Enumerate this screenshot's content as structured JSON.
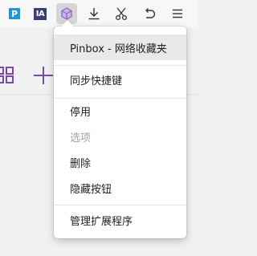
{
  "toolbar": {
    "extensions": [
      {
        "name": "pocket-extension",
        "label": "P",
        "color": "#1f95d8"
      },
      {
        "name": "internet-archive-extension",
        "label": "IA",
        "color": "#3a3f73"
      },
      {
        "name": "pinbox-extension",
        "active": true
      }
    ],
    "icons": [
      "download-icon",
      "scissors-icon",
      "undo-icon",
      "menu-icon"
    ]
  },
  "context_menu": {
    "title": "Pinbox - 网络收藏夹",
    "items": [
      {
        "label": "同步快捷键",
        "enabled": true
      },
      {
        "label": "停用",
        "enabled": true
      },
      {
        "label": "选项",
        "enabled": false
      },
      {
        "label": "删除",
        "enabled": true
      },
      {
        "label": "隐藏按钮",
        "enabled": true
      },
      {
        "label": "管理扩展程序",
        "enabled": true
      }
    ]
  },
  "colors": {
    "accent": "#7b4aa8",
    "pinbox_icon": "#8a64c4",
    "menu_hover": "#e9e9e9",
    "disabled_text": "#a3a3a3"
  }
}
